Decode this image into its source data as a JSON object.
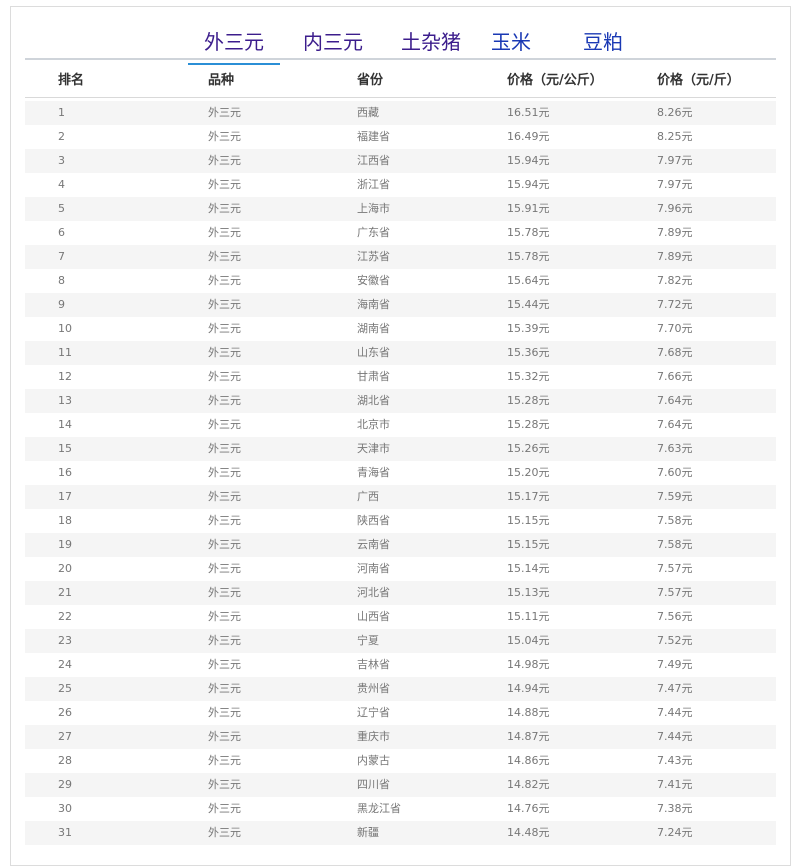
{
  "tabs": [
    "外三元",
    "内三元",
    "土杂猪",
    "玉米",
    "豆粕"
  ],
  "active_tab": 0,
  "headers": [
    "排名",
    "品种",
    "省份",
    "价格（元/公斤）",
    "价格（元/斤）"
  ],
  "rows": [
    [
      "1",
      "外三元",
      "西藏",
      "16.51元",
      "8.26元"
    ],
    [
      "2",
      "外三元",
      "福建省",
      "16.49元",
      "8.25元"
    ],
    [
      "3",
      "外三元",
      "江西省",
      "15.94元",
      "7.97元"
    ],
    [
      "4",
      "外三元",
      "浙江省",
      "15.94元",
      "7.97元"
    ],
    [
      "5",
      "外三元",
      "上海市",
      "15.91元",
      "7.96元"
    ],
    [
      "6",
      "外三元",
      "广东省",
      "15.78元",
      "7.89元"
    ],
    [
      "7",
      "外三元",
      "江苏省",
      "15.78元",
      "7.89元"
    ],
    [
      "8",
      "外三元",
      "安徽省",
      "15.64元",
      "7.82元"
    ],
    [
      "9",
      "外三元",
      "海南省",
      "15.44元",
      "7.72元"
    ],
    [
      "10",
      "外三元",
      "湖南省",
      "15.39元",
      "7.70元"
    ],
    [
      "11",
      "外三元",
      "山东省",
      "15.36元",
      "7.68元"
    ],
    [
      "12",
      "外三元",
      "甘肃省",
      "15.32元",
      "7.66元"
    ],
    [
      "13",
      "外三元",
      "湖北省",
      "15.28元",
      "7.64元"
    ],
    [
      "14",
      "外三元",
      "北京市",
      "15.28元",
      "7.64元"
    ],
    [
      "15",
      "外三元",
      "天津市",
      "15.26元",
      "7.63元"
    ],
    [
      "16",
      "外三元",
      "青海省",
      "15.20元",
      "7.60元"
    ],
    [
      "17",
      "外三元",
      "广西",
      "15.17元",
      "7.59元"
    ],
    [
      "18",
      "外三元",
      "陕西省",
      "15.15元",
      "7.58元"
    ],
    [
      "19",
      "外三元",
      "云南省",
      "15.15元",
      "7.58元"
    ],
    [
      "20",
      "外三元",
      "河南省",
      "15.14元",
      "7.57元"
    ],
    [
      "21",
      "外三元",
      "河北省",
      "15.13元",
      "7.57元"
    ],
    [
      "22",
      "外三元",
      "山西省",
      "15.11元",
      "7.56元"
    ],
    [
      "23",
      "外三元",
      "宁夏",
      "15.04元",
      "7.52元"
    ],
    [
      "24",
      "外三元",
      "吉林省",
      "14.98元",
      "7.49元"
    ],
    [
      "25",
      "外三元",
      "贵州省",
      "14.94元",
      "7.47元"
    ],
    [
      "26",
      "外三元",
      "辽宁省",
      "14.88元",
      "7.44元"
    ],
    [
      "27",
      "外三元",
      "重庆市",
      "14.87元",
      "7.44元"
    ],
    [
      "28",
      "外三元",
      "内蒙古",
      "14.86元",
      "7.43元"
    ],
    [
      "29",
      "外三元",
      "四川省",
      "14.82元",
      "7.41元"
    ],
    [
      "30",
      "外三元",
      "黑龙江省",
      "14.76元",
      "7.38元"
    ],
    [
      "31",
      "外三元",
      "新疆",
      "14.48元",
      "7.24元"
    ]
  ],
  "colors": {
    "tab_primary": "#3c1d8c",
    "tab_secondary": "#1a39b4",
    "tab_underline": "#2b8fd6",
    "row_alt": "#f5f5f5"
  }
}
